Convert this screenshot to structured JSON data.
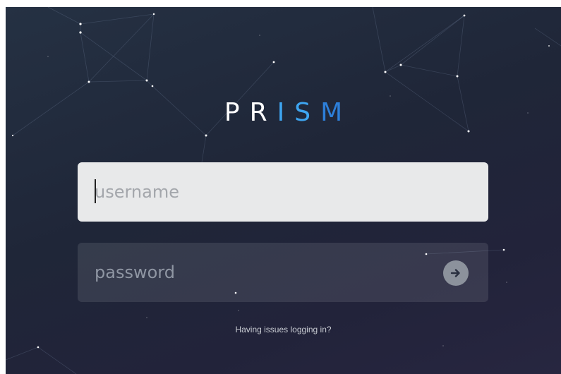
{
  "logo": {
    "letters": [
      "P",
      "R",
      "I",
      "S",
      "M"
    ],
    "colors": [
      "#ffffff",
      "#ffffff",
      "#3ea6f2",
      "#3ea6f2",
      "#2d7fd9"
    ]
  },
  "login": {
    "username_placeholder": "username",
    "username_value": "",
    "password_placeholder": "password",
    "password_value": "",
    "submit_icon": "arrow-right-icon",
    "help_link": "Having issues logging in?"
  },
  "colors": {
    "background": "#222a3c",
    "accent": "#3ea6f2",
    "field_light": "#e8e9ea"
  }
}
